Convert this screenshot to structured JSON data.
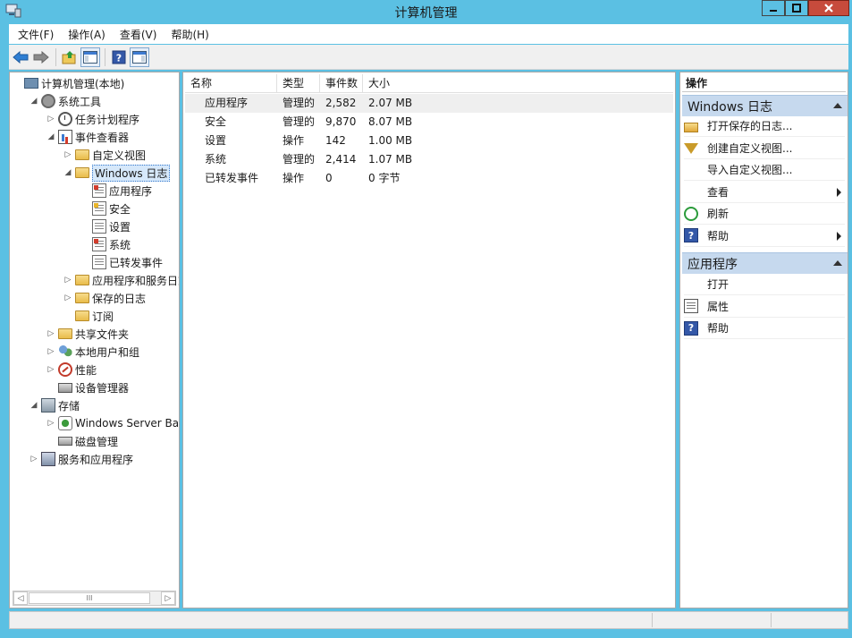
{
  "window": {
    "title": "计算机管理"
  },
  "menu": [
    "文件(F)",
    "操作(A)",
    "查看(V)",
    "帮助(H)"
  ],
  "toolbar": {
    "icons": [
      "back-arrow-icon",
      "forward-arrow-icon",
      "up-folder-icon",
      "show-hide-tree-icon",
      "help-icon",
      "show-hide-action-pane-icon"
    ]
  },
  "tree": {
    "items": [
      {
        "label": "计算机管理(本地)",
        "level": 0,
        "arrow": "",
        "icon": "computer-management-icon"
      },
      {
        "label": "系统工具",
        "level": 1,
        "arrow": "◢",
        "icon": "system-tools-icon"
      },
      {
        "label": "任务计划程序",
        "level": 2,
        "arrow": "▷",
        "icon": "task-scheduler-icon"
      },
      {
        "label": "事件查看器",
        "level": 2,
        "arrow": "◢",
        "icon": "event-viewer-icon"
      },
      {
        "label": "自定义视图",
        "level": 3,
        "arrow": "▷",
        "icon": "folder-icon"
      },
      {
        "label": "Windows 日志",
        "level": 3,
        "arrow": "◢",
        "icon": "folder-icon",
        "selected": true
      },
      {
        "label": "应用程序",
        "level": 4,
        "arrow": "",
        "icon": "log-icon"
      },
      {
        "label": "安全",
        "level": 4,
        "arrow": "",
        "icon": "log-icon"
      },
      {
        "label": "设置",
        "level": 4,
        "arrow": "",
        "icon": "log-icon"
      },
      {
        "label": "系统",
        "level": 4,
        "arrow": "",
        "icon": "log-icon"
      },
      {
        "label": "已转发事件",
        "level": 4,
        "arrow": "",
        "icon": "log-icon"
      },
      {
        "label": "应用程序和服务日志",
        "level": 3,
        "arrow": "▷",
        "icon": "folder-icon"
      },
      {
        "label": "保存的日志",
        "level": 3,
        "arrow": "▷",
        "icon": "folder-icon"
      },
      {
        "label": "订阅",
        "level": 3,
        "arrow": "",
        "icon": "folder-icon"
      },
      {
        "label": "共享文件夹",
        "level": 2,
        "arrow": "▷",
        "icon": "shared-folders-icon"
      },
      {
        "label": "本地用户和组",
        "level": 2,
        "arrow": "▷",
        "icon": "local-users-icon"
      },
      {
        "label": "性能",
        "level": 2,
        "arrow": "▷",
        "icon": "performance-icon"
      },
      {
        "label": "设备管理器",
        "level": 2,
        "arrow": "",
        "icon": "device-manager-icon"
      },
      {
        "label": "存储",
        "level": 1,
        "arrow": "◢",
        "icon": "storage-icon"
      },
      {
        "label": "Windows Server Back",
        "level": 2,
        "arrow": "▷",
        "icon": "windows-server-backup-icon"
      },
      {
        "label": "磁盘管理",
        "level": 2,
        "arrow": "",
        "icon": "disk-management-icon"
      },
      {
        "label": "服务和应用程序",
        "level": 1,
        "arrow": "▷",
        "icon": "services-applications-icon"
      }
    ],
    "scroll_thumb_glyph": "III",
    "scroll_left": "◁",
    "scroll_right": "▷"
  },
  "list": {
    "columns": [
      "名称",
      "类型",
      "事件数",
      "大小"
    ],
    "rows": [
      {
        "name": "应用程序",
        "type": "管理的",
        "count": "2,582",
        "size": "2.07 MB",
        "selected": true
      },
      {
        "name": "安全",
        "type": "管理的",
        "count": "9,870",
        "size": "8.07 MB"
      },
      {
        "name": "设置",
        "type": "操作",
        "count": "142",
        "size": "1.00 MB"
      },
      {
        "name": "系统",
        "type": "管理的",
        "count": "2,414",
        "size": "1.07 MB"
      },
      {
        "name": "已转发事件",
        "type": "操作",
        "count": "0",
        "size": "0 字节"
      }
    ]
  },
  "actions": {
    "header": "操作",
    "section1": {
      "title": "Windows 日志",
      "items": [
        {
          "label": "打开保存的日志...",
          "icon": "open-log-icon"
        },
        {
          "label": "创建自定义视图...",
          "icon": "filter-icon"
        },
        {
          "label": "导入自定义视图...",
          "icon": ""
        },
        {
          "label": "查看",
          "icon": "",
          "submenu": true
        },
        {
          "label": "刷新",
          "icon": "refresh-icon"
        },
        {
          "label": "帮助",
          "icon": "help-icon",
          "submenu": true
        }
      ]
    },
    "section2": {
      "title": "应用程序",
      "items": [
        {
          "label": "打开",
          "icon": ""
        },
        {
          "label": "属性",
          "icon": "properties-icon"
        },
        {
          "label": "帮助",
          "icon": "help-icon"
        }
      ]
    }
  }
}
